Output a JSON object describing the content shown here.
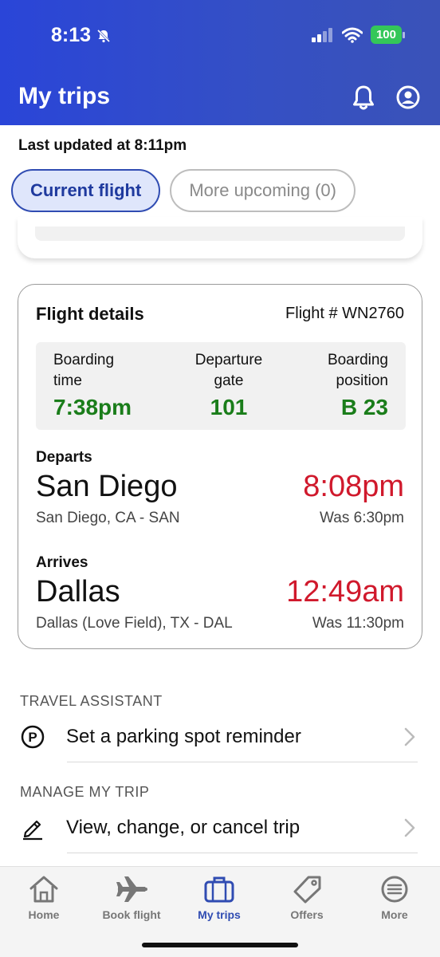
{
  "status": {
    "time": "8:13",
    "battery": "100"
  },
  "header": {
    "title": "My trips"
  },
  "updated": "Last updated at 8:11pm",
  "tabs": [
    {
      "label": "Current flight",
      "active": true
    },
    {
      "label": "More upcoming (0)",
      "active": false
    }
  ],
  "flight": {
    "title": "Flight details",
    "flight_number": "Flight # WN2760",
    "boarding_time_label_1": "Boarding",
    "boarding_time_label_2": "time",
    "boarding_time": "7:38pm",
    "gate_label_1": "Departure",
    "gate_label_2": "gate",
    "gate": "101",
    "position_label_1": "Boarding",
    "position_label_2": "position",
    "position": "B 23",
    "departs": {
      "label": "Departs",
      "city": "San Diego",
      "airport": "San Diego, CA - SAN",
      "time": "8:08pm",
      "was": "Was 6:30pm"
    },
    "arrives": {
      "label": "Arrives",
      "city": "Dallas",
      "airport": "Dallas (Love Field), TX - DAL",
      "time": "12:49am",
      "was": "Was 11:30pm"
    }
  },
  "travel_assistant": {
    "heading": "TRAVEL ASSISTANT",
    "item": "Set a parking spot reminder"
  },
  "manage_trip": {
    "heading": "MANAGE MY TRIP",
    "item": "View, change, or cancel trip"
  },
  "tabbar": [
    {
      "label": "Home",
      "icon": "home-icon"
    },
    {
      "label": "Book flight",
      "icon": "airplane-icon"
    },
    {
      "label": "My trips",
      "icon": "briefcase-icon",
      "active": true
    },
    {
      "label": "Offers",
      "icon": "tag-icon"
    },
    {
      "label": "More",
      "icon": "menu-icon"
    }
  ],
  "colors": {
    "brand_blue": "#304CB2",
    "green": "#1a7d1a",
    "red": "#d0192c"
  }
}
